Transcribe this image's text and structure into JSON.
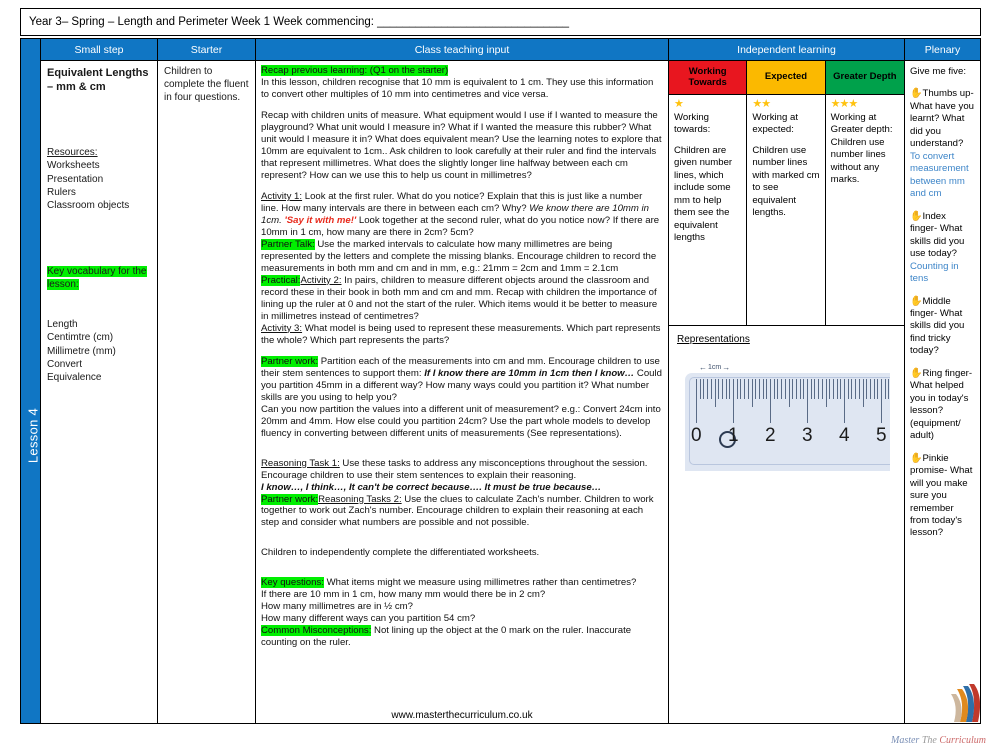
{
  "document": {
    "title_line": "Year 3– Spring – Length and Perimeter Week 1 Week commencing: ______________________________",
    "lesson_label": "Lesson 4",
    "website_url": "www.masterthecurriculum.co.uk",
    "logo_words": [
      "Master",
      "The",
      "Curriculum"
    ]
  },
  "colors": {
    "header_blue": "#1076c4",
    "highlight_green": "#00ef00",
    "working_towards_red": "#e8161f",
    "expected_amber": "#fbb900",
    "greater_depth_green": "#00a14b",
    "answer_blue": "#3d85c8",
    "star_gold": "#ffc20e"
  },
  "columns": {
    "small_step": "Small step",
    "starter": "Starter",
    "class_teaching_input": "Class teaching input",
    "independent_learning": "Independent learning",
    "plenary": "Plenary"
  },
  "small_step": {
    "title": "Equivalent Lengths – mm & cm",
    "resources_heading": "Resources:",
    "resources": [
      "Worksheets",
      "Presentation",
      "Rulers",
      "Classroom objects"
    ],
    "vocab_heading": "Key vocabulary for the lesson:",
    "vocab": [
      "Length",
      "Centimtre (cm)",
      "Millimetre (mm)",
      "Convert",
      "Equivalence"
    ]
  },
  "starter": {
    "text": "Children to complete the fluent in four questions."
  },
  "class_teaching_input": {
    "recap_heading": "Recap previous learning: (Q1 on the starter)",
    "recap_para": "In this lesson, children recognise that 10 mm is equivalent to 1 cm. They use this information to convert other multiples of 10 mm into centimetres and vice versa.",
    "recap_para2": "Recap with children units of measure. What equipment would I use if I wanted to measure the playground?  What unit would I measure in?  What if I wanted the measure this rubber?  What unit would I measure it in?  What does equivalent mean? Use the learning notes to explore that 10mm are equivalent to 1cm..  Ask children to look carefully at their ruler and find the intervals that represent millimetres.  What does the slightly longer line halfway between each cm represent?   How can we use this to help us count in millimetres?",
    "activity1_label": "Activity 1:",
    "activity1_text_a": "  Look at the first ruler.  What do you notice?  Explain that this is just like a number line.  How many intervals are there in between each cm? Why? ",
    "activity1_italic": "We know there are 10mm in 1cm.",
    "activity1_red": "'Say it with me!'",
    "activity1_text_b": " Look together at the second ruler, what do you notice now? If there are 10mm in 1 cm, how many are there in 2cm? 5cm?",
    "partner_talk_label": "Partner Talk:",
    "partner_talk_text": " Use the marked intervals to calculate how many millimetres are being represented by the letters and complete the missing blanks.  Encourage children to record the measurements in both mm and cm and in mm, e.g.: 21mm = 2cm and 1mm = 2.1cm",
    "practical_label": "Practical:",
    "activity2_label": "Activity 2:",
    "activity2_text": "  In pairs, children to measure different objects around the classroom and record these in their book in both mm and cm and mm.   Recap with children the importance of lining up the ruler at 0 and not the start of the ruler.  Which items would it be better to measure in millimetres instead of centimetres?",
    "activity3_label": "Activity 3:",
    "activity3_text": " What model is being used to represent these measurements.  Which part represents the whole?  Which part represents the parts?",
    "partner_work_label": "Partner work:",
    "partner_work_text_a": " Partition each of the measurements into cm and mm.  Encourage children to use their stem sentences to support them:  ",
    "partner_work_bold": "If I know there are 10mm in 1cm then I know…",
    "partner_work_text_b": "  Could  you partition 45mm in a different way?  How many ways could you partition it? What number skills are you using to help you?",
    "convert_para": "Can you now partition the values into a different unit of measurement?  e.g.: Convert 24cm into 20mm and 4mm.  How else could you partition 24cm?  Use the part whole models to develop fluency in converting between different units of measurements (See representations).",
    "reasoning1_label": "Reasoning Task 1:",
    "reasoning1_text": " Use these tasks to address any misconceptions throughout the session. Encourage children to use their stem sentences to explain their reasoning.",
    "stem_sentences": "I know…, I think…, It can't be correct because…. It must be true because…",
    "partner_work2_label": "Partner work:",
    "reasoning2_label": "Reasoning Tasks 2:",
    "reasoning2_text": " Use the clues to calculate Zach's number. Children to work together to work out Zach's number.  Encourage children to explain their reasoning at each step and consider what numbers are possible and not possible.",
    "worksheets_line": "Children to independently complete the differentiated worksheets.",
    "key_questions_label": "Key questions:",
    "key_questions_first": " What items might we measure using millimetres rather than centimetres?",
    "key_questions_rest": [
      "If there are 10 mm in 1 cm, how many mm would there be in 2 cm?",
      "How many millimetres are in ½ cm?",
      "How many different ways can you partition 54 cm?"
    ],
    "misconceptions_label": "Common Misconceptions:",
    "misconceptions_text": " Not lining up the object at the 0 mark on the ruler.  Inaccurate counting on the ruler."
  },
  "independent_learning": {
    "bands": [
      {
        "header": "Working Towards",
        "header_color": "#e8161f",
        "stars": "★",
        "sub": "Working towards:",
        "body": "Children are given number lines, which include some mm to help them see the equivalent lengths"
      },
      {
        "header": "Expected",
        "header_color": "#fbb900",
        "stars": "★★",
        "sub": "Working at expected:",
        "body": "Children  use number lines with marked cm to see equivalent lengths."
      },
      {
        "header": "Greater Depth",
        "header_color": "#00a14b",
        "stars": "★★★",
        "sub": "Working at Greater depth:",
        "body": "Children use number lines without any marks."
      }
    ],
    "representations_heading": "Representations",
    "ruler": {
      "cm_label": "1cm",
      "numbers": [
        "0",
        "1",
        "2",
        "3",
        "4",
        "5"
      ]
    }
  },
  "plenary": {
    "intro": "Give me five:",
    "items": [
      {
        "icon": "hand-thumbs-up-icon",
        "prompt": "Thumbs up- What have you learnt? What did you understand?",
        "answer": "To convert measurement between mm and cm"
      },
      {
        "icon": "hand-index-finger-icon",
        "prompt": "Index finger- What skills did you use today?",
        "answer": "Counting in tens"
      },
      {
        "icon": "hand-middle-finger-icon",
        "prompt": "Middle finger- What skills did you find tricky today?",
        "answer": ""
      },
      {
        "icon": "hand-ring-finger-icon",
        "prompt": "Ring finger- What helped you in today's lesson? (equipment/ adult)",
        "answer": ""
      },
      {
        "icon": "hand-pinkie-icon",
        "prompt": "Pinkie promise- What will you make sure you remember from today's lesson?",
        "answer": ""
      }
    ]
  }
}
